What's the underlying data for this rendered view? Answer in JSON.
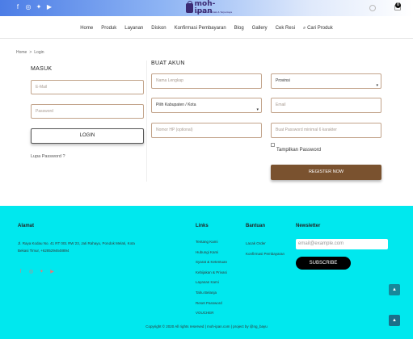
{
  "header": {
    "social_icons": [
      "facebook-icon",
      "instagram-icon",
      "twitter-icon",
      "youtube-icon"
    ],
    "logo_text": "moh-ipan",
    "logo_tagline": "Mitra Usaha Terbaik & Terpercaya",
    "cart_count": "0"
  },
  "nav": {
    "items": [
      "Home",
      "Produk",
      "Layanan",
      "Diskon",
      "Konfirmasi Pembayaran",
      "Blog",
      "Gallery",
      "Cek Resi",
      "Cari Produk"
    ]
  },
  "breadcrumb": {
    "home": "Home",
    "separator": ">",
    "current": "Login"
  },
  "login": {
    "title": "MASUK",
    "email_placeholder": "E-Mail",
    "password_placeholder": "Password",
    "button_label": "LOGIN",
    "forgot_label": "Lupa Password ?"
  },
  "register": {
    "title": "BUAT AKUN",
    "name_placeholder": "Nama Lengkap",
    "province_value": "Provinsi",
    "city_value": "Pilih Kabupaten / Kota",
    "email_placeholder": "Email",
    "phone_placeholder": "Nomor HP (optional)",
    "password_placeholder": "Buat Password minimal 6 karakter",
    "show_password_label": "Tampilkan Password",
    "button_label": "REGISTER NOW"
  },
  "footer": {
    "address_title": "Alamat",
    "address_text": "Jl. Raya Kodau No. 41 RT 001 RW 23, Jati Rahayu, Pondok Melati, Kota Bekasi Timur, +6285294648894",
    "social_icons": [
      "facebook-icon",
      "instagram-icon",
      "twitter-icon",
      "youtube-icon"
    ],
    "links_title": "Links",
    "links": [
      "Tentang Kami",
      "Hubungi Kami",
      "Syarat & Ketentuan",
      "Kebijakan & Privasi",
      "Layanan Kami",
      "Tahu Belanja",
      "Reset Password",
      "VOUCHER"
    ],
    "bantuan_title": "Bantuan",
    "bantuan_links": [
      "Lacak Order",
      "Konfirmasi Pembayaran"
    ],
    "newsletter_title": "Newsletter",
    "newsletter_placeholder": "email@example.com",
    "subscribe_label": "SUBSCRIBE",
    "copyright": "Copyright © 2020 All rights reserved | moh-ipan.com | project by @ng_bayu"
  },
  "colors": {
    "topbar_start": "#4c7de6",
    "field_border": "#c2a38a",
    "register_button": "#7a522f",
    "footer_bg": "#00e8ee",
    "scrolltop_bg": "#1b6f8a"
  }
}
